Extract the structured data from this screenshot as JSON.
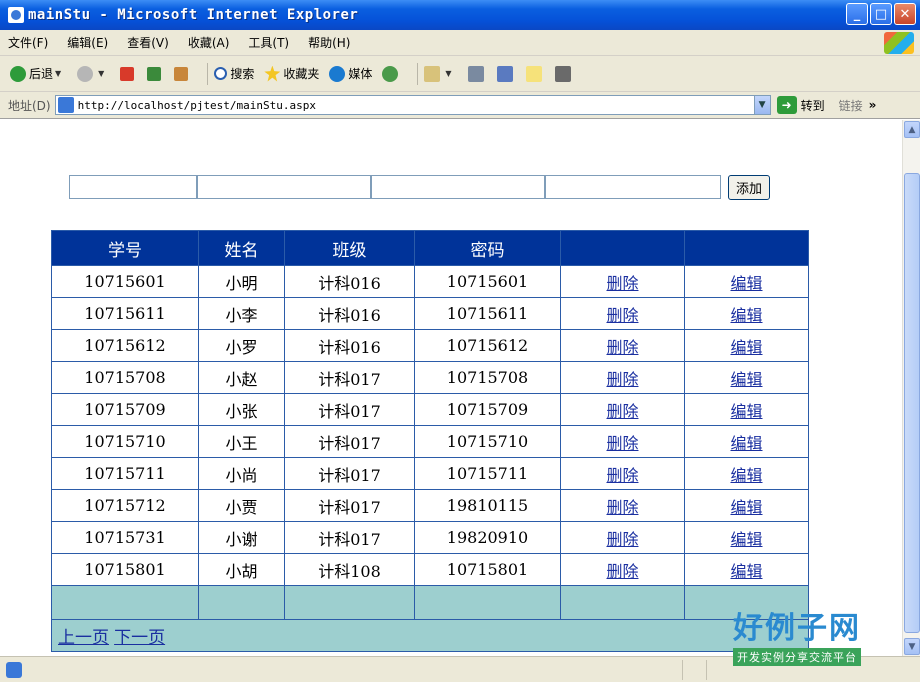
{
  "window": {
    "title": "mainStu - Microsoft Internet Explorer"
  },
  "menubar": {
    "items": [
      "文件(F)",
      "编辑(E)",
      "查看(V)",
      "收藏(A)",
      "工具(T)",
      "帮助(H)"
    ]
  },
  "toolbar": {
    "back": "后退",
    "search": "搜索",
    "favorites": "收藏夹",
    "media": "媒体"
  },
  "address": {
    "label": "地址(D)",
    "url": "http://localhost/pjtest/mainStu.aspx",
    "go": "转到",
    "links": "链接",
    "more": "»"
  },
  "form": {
    "add_label": "添加"
  },
  "table": {
    "headers": [
      "学号",
      "姓名",
      "班级",
      "密码",
      "",
      ""
    ],
    "rows": [
      [
        "10715601",
        "小明",
        "计科016",
        "10715601",
        "删除",
        "编辑"
      ],
      [
        "10715611",
        "小李",
        "计科016",
        "10715611",
        "删除",
        "编辑"
      ],
      [
        "10715612",
        "小罗",
        "计科016",
        "10715612",
        "删除",
        "编辑"
      ],
      [
        "10715708",
        "小赵",
        "计科017",
        "10715708",
        "删除",
        "编辑"
      ],
      [
        "10715709",
        "小张",
        "计科017",
        "10715709",
        "删除",
        "编辑"
      ],
      [
        "10715710",
        "小王",
        "计科017",
        "10715710",
        "删除",
        "编辑"
      ],
      [
        "10715711",
        "小尚",
        "计科017",
        "10715711",
        "删除",
        "编辑"
      ],
      [
        "10715712",
        "小贾",
        "计科017",
        "19810115",
        "删除",
        "编辑"
      ],
      [
        "10715731",
        "小谢",
        "计科017",
        "19820910",
        "删除",
        "编辑"
      ],
      [
        "10715801",
        "小胡",
        "计科108",
        "10715801",
        "删除",
        "编辑"
      ]
    ],
    "pager": {
      "prev": "上一页",
      "next": "下一页"
    }
  },
  "watermark": {
    "title": "好例子网",
    "subtitle": "开发实例分享交流平台"
  },
  "colors": {
    "header_bg": "#003399",
    "footer_bg": "#9dcfcf",
    "link": "#1a2fa0",
    "titlebar": "#0551d8"
  }
}
